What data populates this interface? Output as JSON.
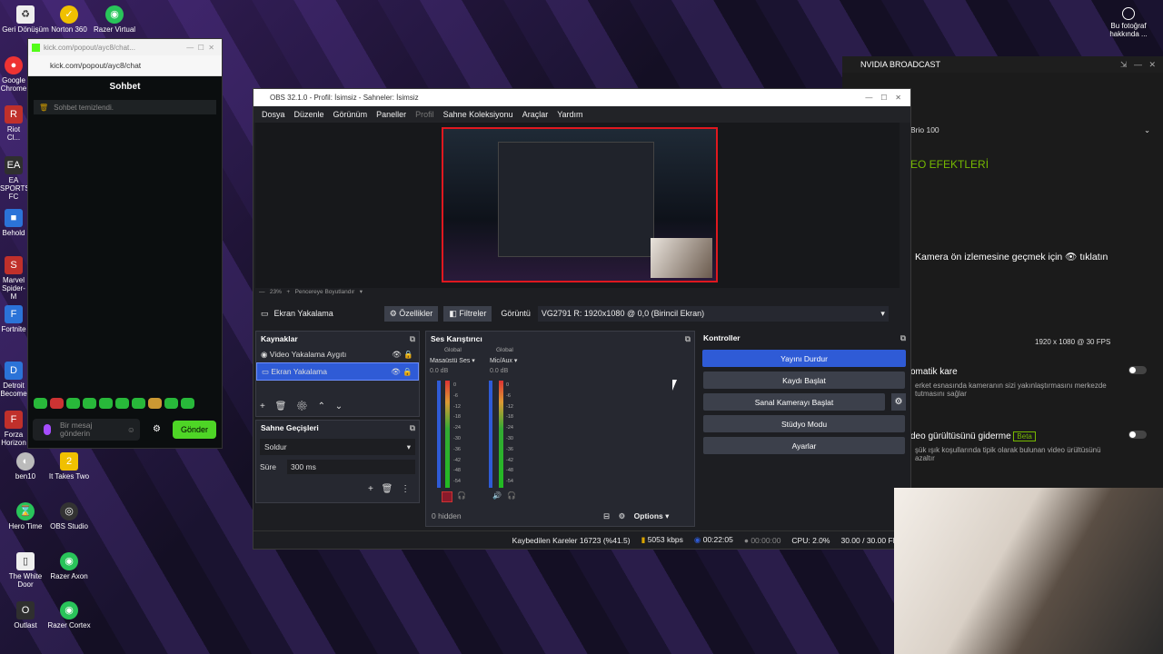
{
  "desktop": {
    "icons": [
      {
        "label": "Geri Dönüşüm",
        "icon": "recycle-bin-icon"
      },
      {
        "label": "Norton 360",
        "icon": "norton-icon"
      },
      {
        "label": "Razer Virtual",
        "icon": "razer-icon"
      },
      {
        "label": "Google Chrome",
        "icon": "chrome-icon"
      },
      {
        "label": "Riot Cl...",
        "icon": "riot-icon"
      },
      {
        "label": "EA SPORTS FC",
        "icon": "ea-icon"
      },
      {
        "label": "Behold",
        "icon": "app-icon"
      },
      {
        "label": "Marvel Spider-M",
        "icon": "spiderman-icon"
      },
      {
        "label": "Fortnite",
        "icon": "fortnite-icon"
      },
      {
        "label": "Detroit Become",
        "icon": "detroit-icon"
      },
      {
        "label": "Forza Horizon",
        "icon": "forza-icon"
      },
      {
        "label": "ben10",
        "icon": "ben10-icon"
      },
      {
        "label": "It Takes Two",
        "icon": "ittakestwo-icon"
      },
      {
        "label": "Hero Time",
        "icon": "herotime-icon"
      },
      {
        "label": "OBS Studio",
        "icon": "obs-icon"
      },
      {
        "label": "The White Door",
        "icon": "whitedoor-icon"
      },
      {
        "label": "Razer Axon",
        "icon": "razer-icon"
      },
      {
        "label": "Outlast",
        "icon": "outlast-icon"
      },
      {
        "label": "Razer Cortex",
        "icon": "razer-icon"
      }
    ],
    "photo_note": "Bu fotoğraf hakkında ..."
  },
  "kick": {
    "tab_title": "kick.com/popout/ayc8/chat...",
    "url": "kick.com/popout/ayc8/chat",
    "title": "Sohbet",
    "note": "Sohbet temizlendi.",
    "input_placeholder": "Bir mesaj gönderin",
    "send": "Gönder"
  },
  "nvidia": {
    "title": "NVIDIA BROADCAST",
    "device": "Brio 100",
    "section": "EO EFEKTLERİ",
    "preview_hint": "Kamera ön izlemesine geçmek için",
    "preview_hint2": "tıklatın",
    "resolution": "1920 x 1080 @ 30 FPS",
    "feature1_title": "omatik kare",
    "feature1_desc": "erket esnasında kameranın sizi yakınlaştırmasını merkezde tutmasını sağlar",
    "feature2_title": "deo gürültüsünü giderme",
    "feature2_badge": "Beta",
    "feature2_desc": "şük ışık koşullarında tipik olarak bulunan video ürültüsünü azaltır"
  },
  "obs": {
    "window_title": "OBS 32.1.0 - Profil: İsimsiz - Sahneler: İsimsiz",
    "menu": [
      "Dosya",
      "Düzenle",
      "Görünüm",
      "Paneller",
      "Profil",
      "Sahne Koleksiyonu",
      "Araçlar",
      "Yardım"
    ],
    "zoom": "23%",
    "fit_label": "Pencereye Boyutlandır",
    "source_bar": {
      "name": "Ekran Yakalama",
      "properties": "Özellikler",
      "filters": "Filtreler",
      "display_label": "Görüntü",
      "display_value": "VG2791 R: 1920x1080 @ 0,0 (Birincil Ekran)"
    },
    "sources": {
      "title": "Kaynaklar",
      "items": [
        "Video Yakalama Aygıtı",
        "Ekran Yakalama"
      ]
    },
    "transitions": {
      "title": "Sahne Geçişleri",
      "type": "Soldur",
      "duration_label": "Süre",
      "duration": "300 ms"
    },
    "mixer": {
      "title": "Ses Karıştırıcı",
      "channels": [
        {
          "tag": "Global",
          "name": "Masaüstü Ses",
          "db": "0.0 dB"
        },
        {
          "tag": "Global",
          "name": "Mic/Aux",
          "db": "0.0 dB"
        }
      ],
      "scale": [
        "0",
        "-6",
        "-12",
        "-18",
        "-24",
        "-30",
        "-36",
        "-42",
        "-48",
        "-54",
        "-60"
      ],
      "hidden": "0 hidden",
      "options": "Options"
    },
    "controls": {
      "title": "Kontroller",
      "stop_stream": "Yayını Durdur",
      "start_record": "Kaydı Başlat",
      "virtual_cam": "Sanal Kamerayı Başlat",
      "studio_mode": "Stüdyo Modu",
      "settings": "Ayarlar"
    },
    "status": {
      "dropped": "Kaybedilen Kareler 16723 (%41.5)",
      "bitrate": "5053 kbps",
      "stream_time": "00:22:05",
      "rec_time": "00:00:00",
      "cpu": "CPU: 2.0%",
      "fps": "30.00 / 30.00 FPS"
    }
  },
  "colors": {
    "accent": "#2f5bd6",
    "obs_bg": "#1d1e22",
    "panel": "#262830",
    "kick_green": "#4ed526"
  }
}
